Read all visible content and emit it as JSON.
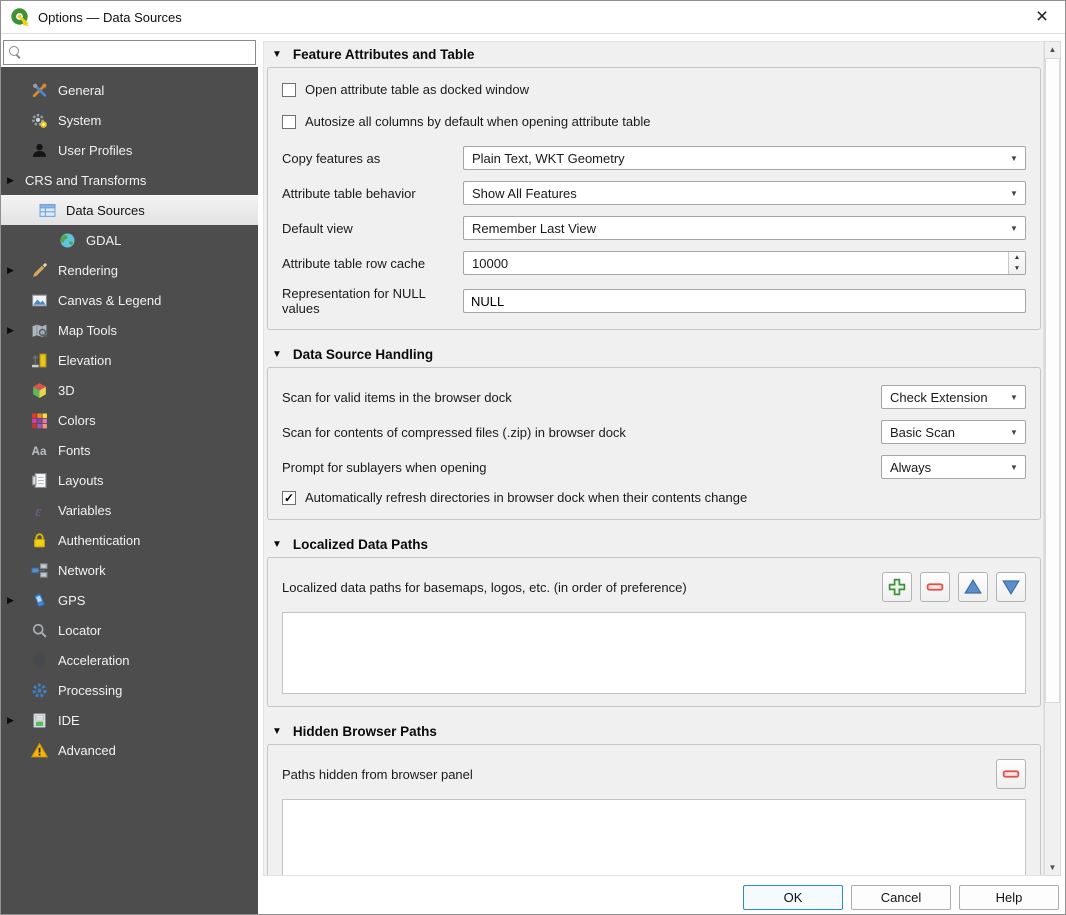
{
  "window": {
    "title": "Options — Data Sources",
    "close_glyph": "×"
  },
  "search": {
    "value": "",
    "placeholder": ""
  },
  "glyphs": {
    "section_triangle": "▼",
    "combo_arrow": "▼",
    "spin_up": "▲",
    "spin_down": "▼",
    "scroll_up": "▲",
    "scroll_down": "▼",
    "check": "✓"
  },
  "sidebar": {
    "items": [
      {
        "label": "General",
        "icon": "general-icon",
        "level": 1,
        "expander": false,
        "selected": false
      },
      {
        "label": "System",
        "icon": "system-icon",
        "level": 1,
        "expander": false,
        "selected": false
      },
      {
        "label": "User Profiles",
        "icon": "user-profiles-icon",
        "level": 1,
        "expander": false,
        "selected": false
      },
      {
        "label": "CRS and Transforms",
        "icon": null,
        "level": 0,
        "expander": true,
        "selected": false
      },
      {
        "label": "Data Sources",
        "icon": "data-sources-icon",
        "level": 2,
        "expander": false,
        "selected": true
      },
      {
        "label": "GDAL",
        "icon": "gdal-icon",
        "level": 3,
        "expander": false,
        "selected": false
      },
      {
        "label": "Rendering",
        "icon": "rendering-icon",
        "level": 1,
        "expander": true,
        "selected": false
      },
      {
        "label": "Canvas & Legend",
        "icon": "canvas-legend-icon",
        "level": 1,
        "expander": false,
        "selected": false
      },
      {
        "label": "Map Tools",
        "icon": "map-tools-icon",
        "level": 1,
        "expander": true,
        "selected": false
      },
      {
        "label": "Elevation",
        "icon": "elevation-icon",
        "level": 1,
        "expander": false,
        "selected": false
      },
      {
        "label": "3D",
        "icon": "three-d-icon",
        "level": 1,
        "expander": false,
        "selected": false
      },
      {
        "label": "Colors",
        "icon": "colors-icon",
        "level": 1,
        "expander": false,
        "selected": false
      },
      {
        "label": "Fonts",
        "icon": "fonts-icon",
        "level": 1,
        "expander": false,
        "selected": false
      },
      {
        "label": "Layouts",
        "icon": "layouts-icon",
        "level": 1,
        "expander": false,
        "selected": false
      },
      {
        "label": "Variables",
        "icon": "variables-icon",
        "level": 1,
        "expander": false,
        "selected": false
      },
      {
        "label": "Authentication",
        "icon": "authentication-icon",
        "level": 1,
        "expander": false,
        "selected": false
      },
      {
        "label": "Network",
        "icon": "network-icon",
        "level": 1,
        "expander": false,
        "selected": false
      },
      {
        "label": "GPS",
        "icon": "gps-icon",
        "level": 1,
        "expander": true,
        "selected": false
      },
      {
        "label": "Locator",
        "icon": "locator-icon",
        "level": 1,
        "expander": false,
        "selected": false
      },
      {
        "label": "Acceleration",
        "icon": "acceleration-icon",
        "level": 1,
        "expander": false,
        "selected": false
      },
      {
        "label": "Processing",
        "icon": "processing-icon",
        "level": 1,
        "expander": false,
        "selected": false
      },
      {
        "label": "IDE",
        "icon": "ide-icon",
        "level": 1,
        "expander": true,
        "selected": false
      },
      {
        "label": "Advanced",
        "icon": "advanced-icon",
        "level": 1,
        "expander": false,
        "selected": false
      }
    ]
  },
  "sections": {
    "feature_attributes": {
      "title": "Feature Attributes and Table",
      "checkbox_docked": {
        "label": "Open attribute table as docked window",
        "checked": false
      },
      "checkbox_autosize": {
        "label": "Autosize all columns by default when opening attribute table",
        "checked": false
      },
      "copy_features": {
        "label": "Copy features as",
        "value": "Plain Text, WKT Geometry"
      },
      "behavior": {
        "label": "Attribute table behavior",
        "value": "Show All Features"
      },
      "default_view": {
        "label": "Default view",
        "value": "Remember Last View"
      },
      "row_cache": {
        "label": "Attribute table row cache",
        "value": "10000"
      },
      "null_repr": {
        "label": "Representation for NULL values",
        "value": "NULL"
      }
    },
    "data_source_handling": {
      "title": "Data Source Handling",
      "scan_valid": {
        "label": "Scan for valid items in the browser dock",
        "value": "Check Extension"
      },
      "scan_zip": {
        "label": "Scan for contents of compressed files (.zip) in browser dock",
        "value": "Basic Scan"
      },
      "prompt_sublayers": {
        "label": "Prompt for sublayers when opening",
        "value": "Always"
      },
      "auto_refresh": {
        "label": "Automatically refresh directories in browser dock when their contents change",
        "checked": true
      }
    },
    "localized_paths": {
      "title": "Localized Data Paths",
      "label": "Localized data paths for basemaps, logos, etc. (in order of preference)"
    },
    "hidden_paths": {
      "title": "Hidden Browser Paths",
      "label": "Paths hidden from browser panel"
    }
  },
  "footer": {
    "ok": "OK",
    "cancel": "Cancel",
    "help": "Help"
  },
  "colors": {
    "sidebar_bg": "#4d4d4d",
    "selected_bg": "#e9e9e9",
    "panel_bg": "#f0f0f0",
    "accent_default_button": "#2f86d2",
    "add_green": "#3f8f3f",
    "remove_red": "#d9534f",
    "move_blue": "#5b8fc9"
  }
}
